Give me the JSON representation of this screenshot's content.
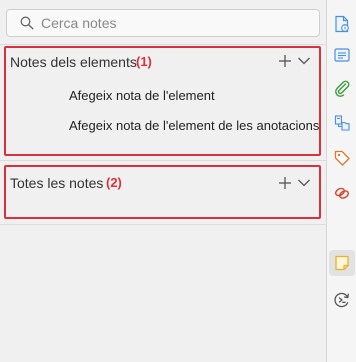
{
  "search": {
    "placeholder": "Cerca notes"
  },
  "sections": [
    {
      "title": "Notes dels elements",
      "badge": "(1)",
      "items": [
        "Afegeix nota de l'element",
        "Afegeix nota de l'element de les anotacions"
      ]
    },
    {
      "title": "Totes les notes",
      "badge": "(2)",
      "items": []
    }
  ],
  "sidebar": {
    "icons": [
      "info-document-icon",
      "abstract-icon",
      "attachments-icon",
      "libraries-collections-icon",
      "tags-icon",
      "related-icon",
      "notes-icon",
      "locate-icon"
    ],
    "active": "notes-icon"
  },
  "colors": {
    "highlight": "#d9303e",
    "accent_blue": "#4a8fe0",
    "attachments_green": "#3a9b3a",
    "tags_orange": "#e4762a",
    "related_red": "#d9442a",
    "notes_yellow": "#e9b22a"
  }
}
